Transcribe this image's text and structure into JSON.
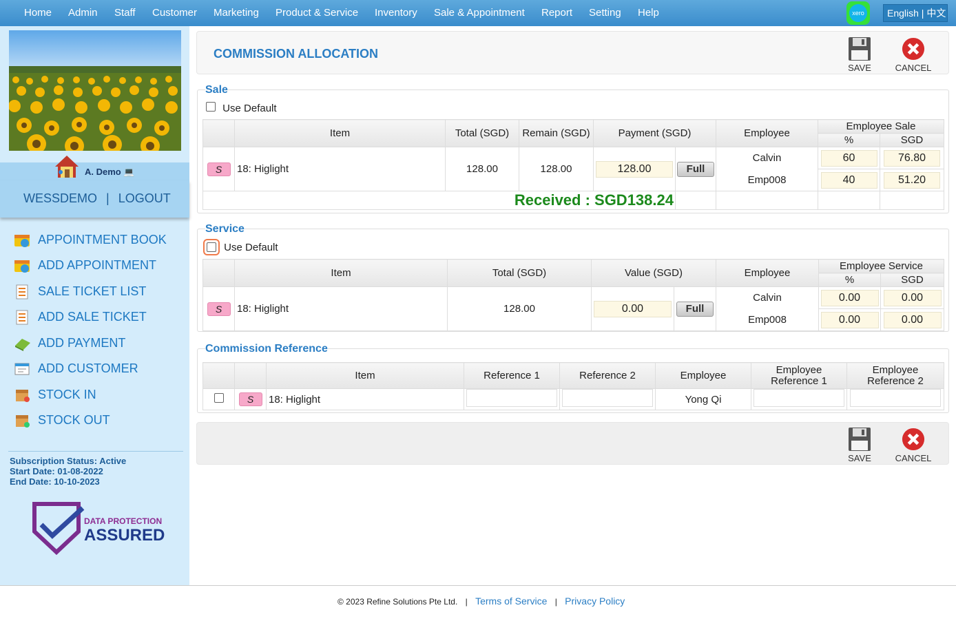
{
  "nav": {
    "items": [
      "Home",
      "Admin",
      "Staff",
      "Customer",
      "Marketing",
      "Product & Service",
      "Inventory",
      "Sale & Appointment",
      "Report",
      "Setting",
      "Help"
    ],
    "xero_label": "xero",
    "lang_label": "English | 中文"
  },
  "sidebar": {
    "user_name": "A. Demo",
    "account": "WESSDEMO",
    "separator": "|",
    "logout": "LOGOUT",
    "links": [
      "APPOINTMENT BOOK",
      "ADD APPOINTMENT",
      "SALE TICKET LIST",
      "ADD SALE TICKET",
      "ADD PAYMENT",
      "ADD CUSTOMER",
      "STOCK IN",
      "STOCK OUT"
    ],
    "subscription_status": "Subscription Status: Active",
    "start_date": "Start Date: 01-08-2022",
    "end_date": "End Date: 10-10-2023",
    "dpa_line1": "DATA PROTECTION",
    "dpa_line2": "ASSURED"
  },
  "header": {
    "title": "COMMISSION ALLOCATION",
    "save_label": "SAVE",
    "cancel_label": "CANCEL"
  },
  "sale": {
    "legend": "Sale",
    "use_default": "Use Default",
    "columns": {
      "item": "Item",
      "total": "Total (SGD)",
      "remain": "Remain (SGD)",
      "payment": "Payment (SGD)",
      "employee": "Employee",
      "emp_sale": "Employee Sale",
      "pct": "%",
      "sgd": "SGD"
    },
    "row": {
      "badge": "S",
      "item": "18: Higlight",
      "total": "128.00",
      "remain": "128.00",
      "payment": "128.00",
      "full": "Full"
    },
    "employees": [
      {
        "name": "Calvin",
        "pct": "60",
        "sgd": "76.80"
      },
      {
        "name": "Emp008",
        "pct": "40",
        "sgd": "51.20"
      }
    ],
    "received": "Received : SGD138.24"
  },
  "service": {
    "legend": "Service",
    "use_default": "Use Default",
    "columns": {
      "item": "Item",
      "total": "Total (SGD)",
      "value": "Value (SGD)",
      "employee": "Employee",
      "emp_service": "Employee Service",
      "pct": "%",
      "sgd": "SGD"
    },
    "row": {
      "badge": "S",
      "item": "18: Higlight",
      "total": "128.00",
      "value": "0.00",
      "full": "Full"
    },
    "employees": [
      {
        "name": "Calvin",
        "pct": "0.00",
        "sgd": "0.00"
      },
      {
        "name": "Emp008",
        "pct": "0.00",
        "sgd": "0.00"
      }
    ]
  },
  "reference": {
    "legend": "Commission Reference",
    "columns": {
      "item": "Item",
      "ref1": "Reference 1",
      "ref2": "Reference 2",
      "employee": "Employee",
      "emp_ref1": "Employee Reference 1",
      "emp_ref2": "Employee Reference 2"
    },
    "row": {
      "badge": "S",
      "item": "18: Higlight",
      "employee": "Yong Qi",
      "ref1": "",
      "ref2": "",
      "emp_ref1": "",
      "emp_ref2": ""
    }
  },
  "footer": {
    "copyright": "© 2023 Refine Solutions Pte Ltd.",
    "terms": "Terms of Service",
    "privacy": "Privacy Policy",
    "sep": "|"
  },
  "colors": {
    "nav": "#4a9bd6",
    "accent": "#2b7ec4",
    "received": "#1c8a1c",
    "sidebar": "#d4ecfb"
  }
}
